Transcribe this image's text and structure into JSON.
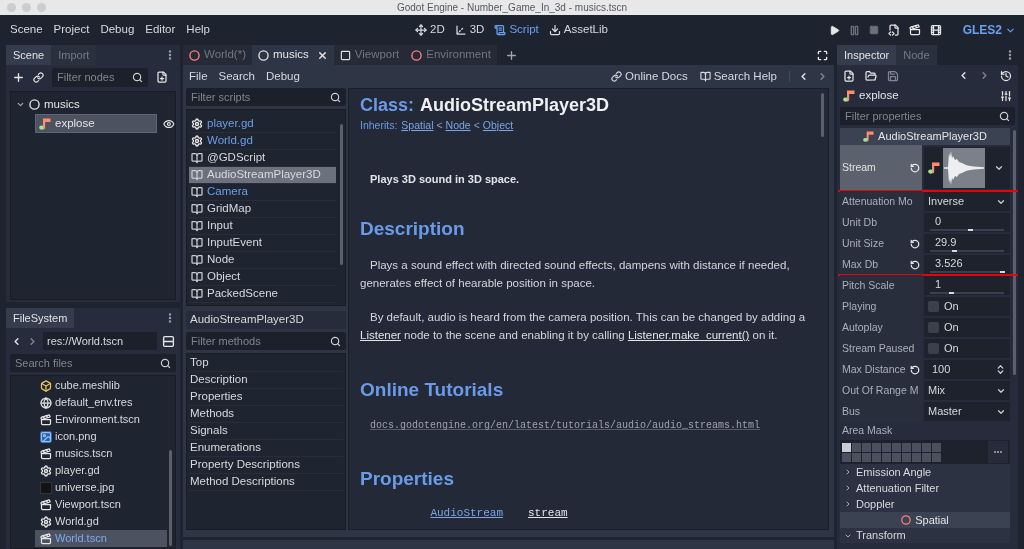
{
  "window": {
    "title": "Godot Engine - Number_Game_In_3d - musics.tscn"
  },
  "menu": [
    "Scene",
    "Project",
    "Debug",
    "Editor",
    "Help"
  ],
  "workspaces": [
    {
      "label": "2D",
      "kind": "canvas",
      "selected": false
    },
    {
      "label": "3D",
      "kind": "spatial",
      "selected": false
    },
    {
      "label": "Script",
      "kind": "script",
      "selected": true
    },
    {
      "label": "AssetLib",
      "kind": "assetlib",
      "selected": false
    }
  ],
  "renderer": "GLES2",
  "scene_dock": {
    "tabs": [
      {
        "label": "Scene",
        "selected": true
      },
      {
        "label": "Import",
        "selected": false
      }
    ],
    "filter": {
      "placeholder": "Filter nodes"
    },
    "tree": [
      {
        "label": "musics",
        "kind": "node",
        "expanded": true,
        "selected": false,
        "children": [
          {
            "label": "explose",
            "kind": "audio",
            "selected": true,
            "visible": true
          }
        ]
      }
    ]
  },
  "filesystem": {
    "tabs": [
      {
        "label": "FileSystem",
        "selected": true
      }
    ],
    "path": "res://World.tscn",
    "search": {
      "placeholder": "Search files"
    },
    "files": [
      {
        "name": "cube.meshlib",
        "kind": "meshlib",
        "selected": false
      },
      {
        "name": "default_env.tres",
        "kind": "environment",
        "selected": false
      },
      {
        "name": "Environment.tscn",
        "kind": "scene",
        "selected": false
      },
      {
        "name": "icon.png",
        "kind": "image",
        "selected": false
      },
      {
        "name": "musics.tscn",
        "kind": "scene",
        "selected": false
      },
      {
        "name": "player.gd",
        "kind": "script",
        "selected": false
      },
      {
        "name": "universe.jpg",
        "kind": "photo",
        "selected": false
      },
      {
        "name": "Viewport.tscn",
        "kind": "scene",
        "selected": false
      },
      {
        "name": "World.gd",
        "kind": "script",
        "selected": false
      },
      {
        "name": "World.tscn",
        "kind": "scene",
        "selected": true
      }
    ]
  },
  "editor_tabs": [
    {
      "label": "World(*)",
      "kind": "spatial",
      "selected": false
    },
    {
      "label": "musics",
      "kind": "node",
      "selected": true
    },
    {
      "label": "Viewport",
      "kind": "viewport",
      "selected": false
    },
    {
      "label": "Environment",
      "kind": "spatial",
      "selected": false
    }
  ],
  "script_editor": {
    "menu": [
      "File",
      "Search",
      "Debug"
    ],
    "toolbar": [
      {
        "label": "Online Docs",
        "kind": "docs"
      },
      {
        "label": "Search Help",
        "kind": "help"
      }
    ],
    "filter": {
      "placeholder": "Filter scripts"
    },
    "scripts": [
      {
        "name": "player.gd",
        "kind": "script",
        "highlighted": true,
        "selected": false
      },
      {
        "name": "World.gd",
        "kind": "script",
        "highlighted": true,
        "selected": false
      },
      {
        "name": "@GDScript",
        "kind": "doc",
        "highlighted": false,
        "selected": false
      },
      {
        "name": "AudioStreamPlayer3D",
        "kind": "doc",
        "highlighted": false,
        "selected": true
      },
      {
        "name": "Camera",
        "kind": "doc",
        "highlighted": true,
        "selected": false
      },
      {
        "name": "GridMap",
        "kind": "doc",
        "highlighted": false,
        "selected": false
      },
      {
        "name": "Input",
        "kind": "doc",
        "highlighted": false,
        "selected": false
      },
      {
        "name": "InputEvent",
        "kind": "doc",
        "highlighted": false,
        "selected": false
      },
      {
        "name": "Node",
        "kind": "doc",
        "highlighted": false,
        "selected": false
      },
      {
        "name": "Object",
        "kind": "doc",
        "highlighted": false,
        "selected": false
      },
      {
        "name": "PackedScene",
        "kind": "doc",
        "highlighted": false,
        "selected": false
      }
    ],
    "current": "AudioStreamPlayer3D",
    "methods_filter": {
      "placeholder": "Filter methods"
    },
    "sections": [
      "Top",
      "Description",
      "Properties",
      "Methods",
      "Signals",
      "Enumerations",
      "Property Descriptions",
      "Method Descriptions"
    ]
  },
  "help": {
    "class_label": "Class:",
    "class_name": "AudioStreamPlayer3D",
    "inherits_label": "Inherits:",
    "inherits": [
      "Spatial",
      "Node",
      "Object"
    ],
    "inherits_separator": "<",
    "brief": "Plays 3D sound in 3D space.",
    "description": {
      "heading": "Description",
      "paragraphs": [
        [
          {
            "text": "Plays a sound effect with directed sound effects, dampens with distance if needed, generates effect of hearable position in space."
          }
        ],
        [
          {
            "text": "By default, audio is heard from the camera position. This can be changed by adding a "
          },
          {
            "link": "Listener"
          },
          {
            "text": " node to the scene and enabling it by calling "
          },
          {
            "link": "Listener.make_current()"
          },
          {
            "text": " on it."
          }
        ]
      ]
    },
    "tutorials": {
      "heading": "Online Tutorials",
      "links": [
        "docs.godotengine.org/en/latest/tutorials/audio/audio_streams.html"
      ]
    },
    "properties": {
      "heading": "Properties",
      "rows": [
        {
          "type": "AudioStream",
          "name": "stream"
        }
      ]
    }
  },
  "inspector": {
    "tabs": [
      {
        "label": "Inspector",
        "selected": true
      },
      {
        "label": "Node",
        "selected": false
      }
    ],
    "object": "explose",
    "filter": {
      "placeholder": "Filter properties"
    },
    "category": "AudioStreamPlayer3D",
    "properties": [
      {
        "label": "Stream",
        "kind": "resource",
        "revert": true,
        "selected": true,
        "annotated": true
      },
      {
        "label": "Attenuation Mo",
        "kind": "enum",
        "value": "Inverse",
        "revert": false,
        "selected": false,
        "annotated": false
      },
      {
        "label": "Unit Db",
        "kind": "number",
        "value": "0",
        "level": 0.54,
        "revert": false,
        "selected": false,
        "annotated": false
      },
      {
        "label": "Unit Size",
        "kind": "number",
        "value": "29.9",
        "level": 0.33,
        "revert": true,
        "selected": false,
        "annotated": false
      },
      {
        "label": "Max Db",
        "kind": "number",
        "value": "3.526",
        "level": 0.97,
        "revert": true,
        "selected": false,
        "annotated": true
      },
      {
        "label": "Pitch Scale",
        "kind": "number",
        "value": "1",
        "level": 0.29,
        "revert": false,
        "selected": false,
        "annotated": false
      },
      {
        "label": "Playing",
        "kind": "check",
        "value": "On",
        "checked": false,
        "revert": false,
        "selected": false,
        "annotated": false
      },
      {
        "label": "Autoplay",
        "kind": "check",
        "value": "On",
        "checked": false,
        "revert": false,
        "selected": false,
        "annotated": false
      },
      {
        "label": "Stream Paused",
        "kind": "check",
        "value": "On",
        "checked": false,
        "revert": false,
        "selected": false,
        "annotated": false
      },
      {
        "label": "Max Distance",
        "kind": "spin",
        "value": "100",
        "revert": true,
        "selected": false,
        "annotated": false
      },
      {
        "label": "Out Of Range M",
        "kind": "enum",
        "value": "Mix",
        "revert": false,
        "selected": false,
        "annotated": false
      },
      {
        "label": "Bus",
        "kind": "enum",
        "value": "Master",
        "revert": false,
        "selected": false,
        "annotated": false
      }
    ],
    "area_mask": {
      "label": "Area Mask",
      "layers": [
        {
          "on": true
        },
        {
          "on": false
        },
        {
          "on": false
        },
        {
          "on": false
        },
        {
          "on": false
        },
        {
          "on": false
        },
        {
          "on": false
        },
        {
          "on": false
        },
        {
          "on": false
        },
        {
          "on": false
        },
        {
          "on": false
        },
        {
          "on": false
        },
        {
          "on": false
        },
        {
          "on": false
        },
        {
          "on": false
        },
        {
          "on": false
        },
        {
          "on": false
        },
        {
          "on": false
        },
        {
          "on": false
        },
        {
          "on": false
        }
      ]
    },
    "groups": [
      {
        "label": "Emission Angle",
        "expanded": false
      },
      {
        "label": "Attenuation Filter",
        "expanded": false
      },
      {
        "label": "Doppler",
        "expanded": false
      }
    ],
    "category2": "Spatial",
    "groups2": [
      {
        "label": "Transform",
        "expanded": true
      }
    ]
  }
}
